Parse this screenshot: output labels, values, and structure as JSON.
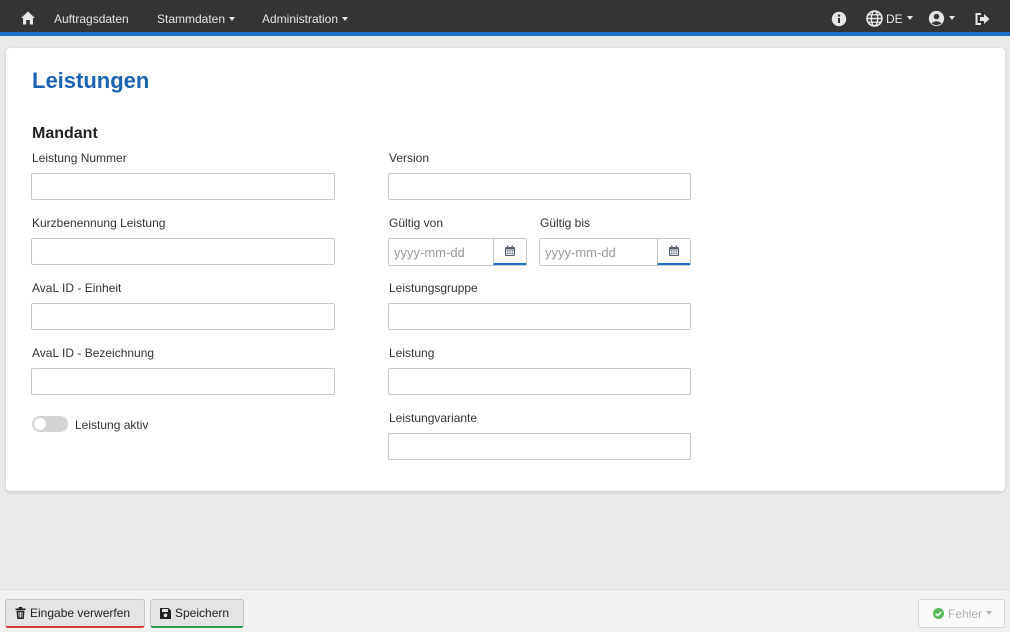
{
  "nav": {
    "home_icon": "home-icon",
    "links": [
      "Auftragsdaten",
      "Stammdaten",
      "Administration"
    ],
    "language": "DE",
    "info_icon": "info-icon",
    "globe_icon": "globe-icon",
    "user_icon": "user-circle-icon",
    "logout_icon": "logout-icon"
  },
  "page": {
    "title": "Leistungen",
    "section": "Mandant"
  },
  "form": {
    "leistung_nummer": {
      "label": "Leistung Nummer",
      "value": ""
    },
    "version": {
      "label": "Version",
      "value": ""
    },
    "kurzbenennung": {
      "label": "Kurzbenennung Leistung",
      "value": ""
    },
    "gueltig_von": {
      "label": "Gültig von",
      "placeholder": "yyyy-mm-dd"
    },
    "gueltig_bis": {
      "label": "Gültig bis",
      "placeholder": "yyyy-mm-dd"
    },
    "aval_einheit": {
      "label": "AvaL ID - Einheit",
      "value": ""
    },
    "leistungsgruppe": {
      "label": "Leistungsgruppe",
      "value": ""
    },
    "aval_bezeichnung": {
      "label": "AvaL ID - Bezeichnung",
      "value": ""
    },
    "leistung": {
      "label": "Leistung",
      "value": ""
    },
    "leistung_aktiv": {
      "label": "Leistung aktiv",
      "checked": false
    },
    "leistungvariante": {
      "label": "Leistungvariante",
      "value": ""
    }
  },
  "footer": {
    "discard_label": "Eingabe verwerfen",
    "save_label": "Speichern",
    "error_label": "Fehler"
  },
  "colors": {
    "accent": "#1a73c9",
    "title": "#1b64b0",
    "navbar": "#343434",
    "discard": "#d63a3a",
    "save": "#2e9a4a",
    "ok": "#5cb85c"
  }
}
